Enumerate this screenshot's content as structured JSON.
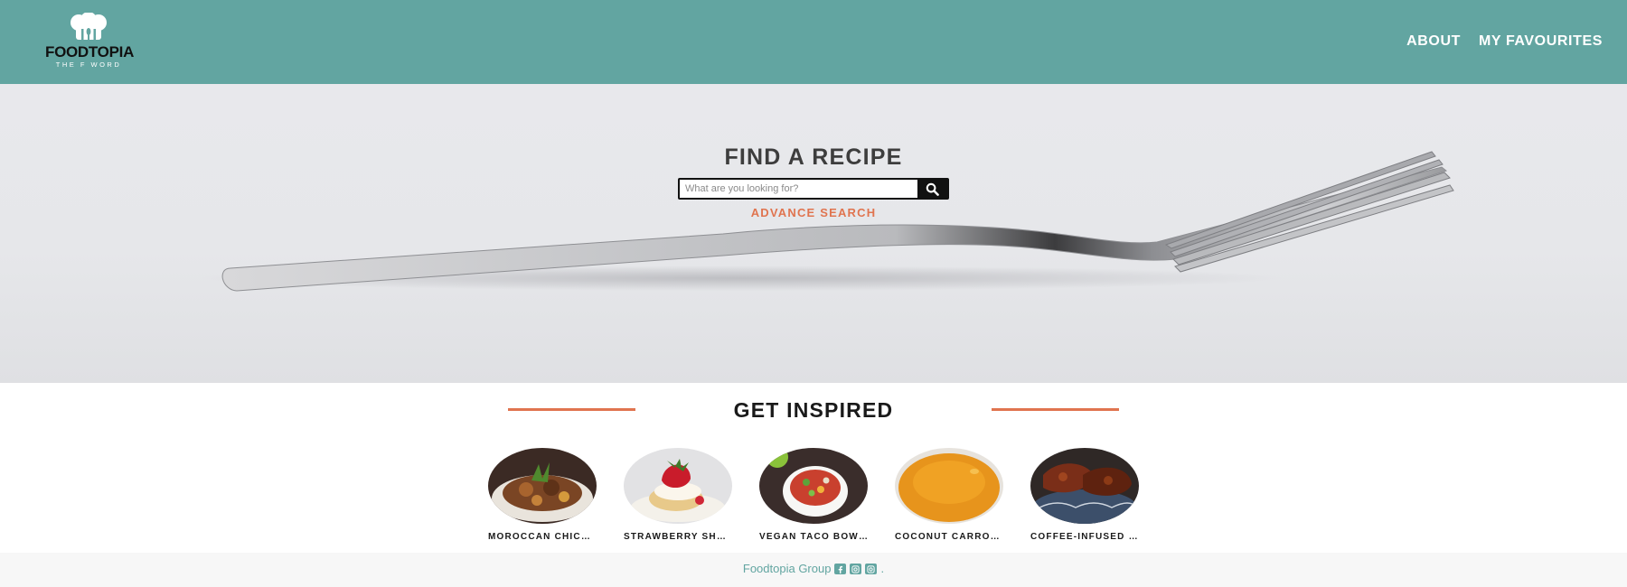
{
  "brand": {
    "name": "FOODTOPIA",
    "tagline": "THE F WORD"
  },
  "nav": {
    "items": [
      "ABOUT",
      "MY FAVOURITES"
    ]
  },
  "hero": {
    "title": "FIND A RECIPE",
    "search_placeholder": "What are you looking for?",
    "advance_label": "ADVANCE SEARCH"
  },
  "inspired": {
    "title": "GET INSPIRED",
    "cards": [
      {
        "label": "MOROCCAN CHICKEN"
      },
      {
        "label": "STRAWBERRY SHORTCAKE"
      },
      {
        "label": "VEGAN TACO BOWLS"
      },
      {
        "label": "COCONUT CARROT-GINGER SOUP"
      },
      {
        "label": "COFFEE-INFUSED BBQ RIBS"
      }
    ]
  },
  "footer": {
    "text": "Foodtopia Group",
    "social": [
      "facebook-icon",
      "instagram-icon",
      "instagram-icon"
    ],
    "end": "."
  },
  "colors": {
    "header": "#62a5a1",
    "accent": "#e0744f",
    "footer_text": "#62a5a1"
  }
}
